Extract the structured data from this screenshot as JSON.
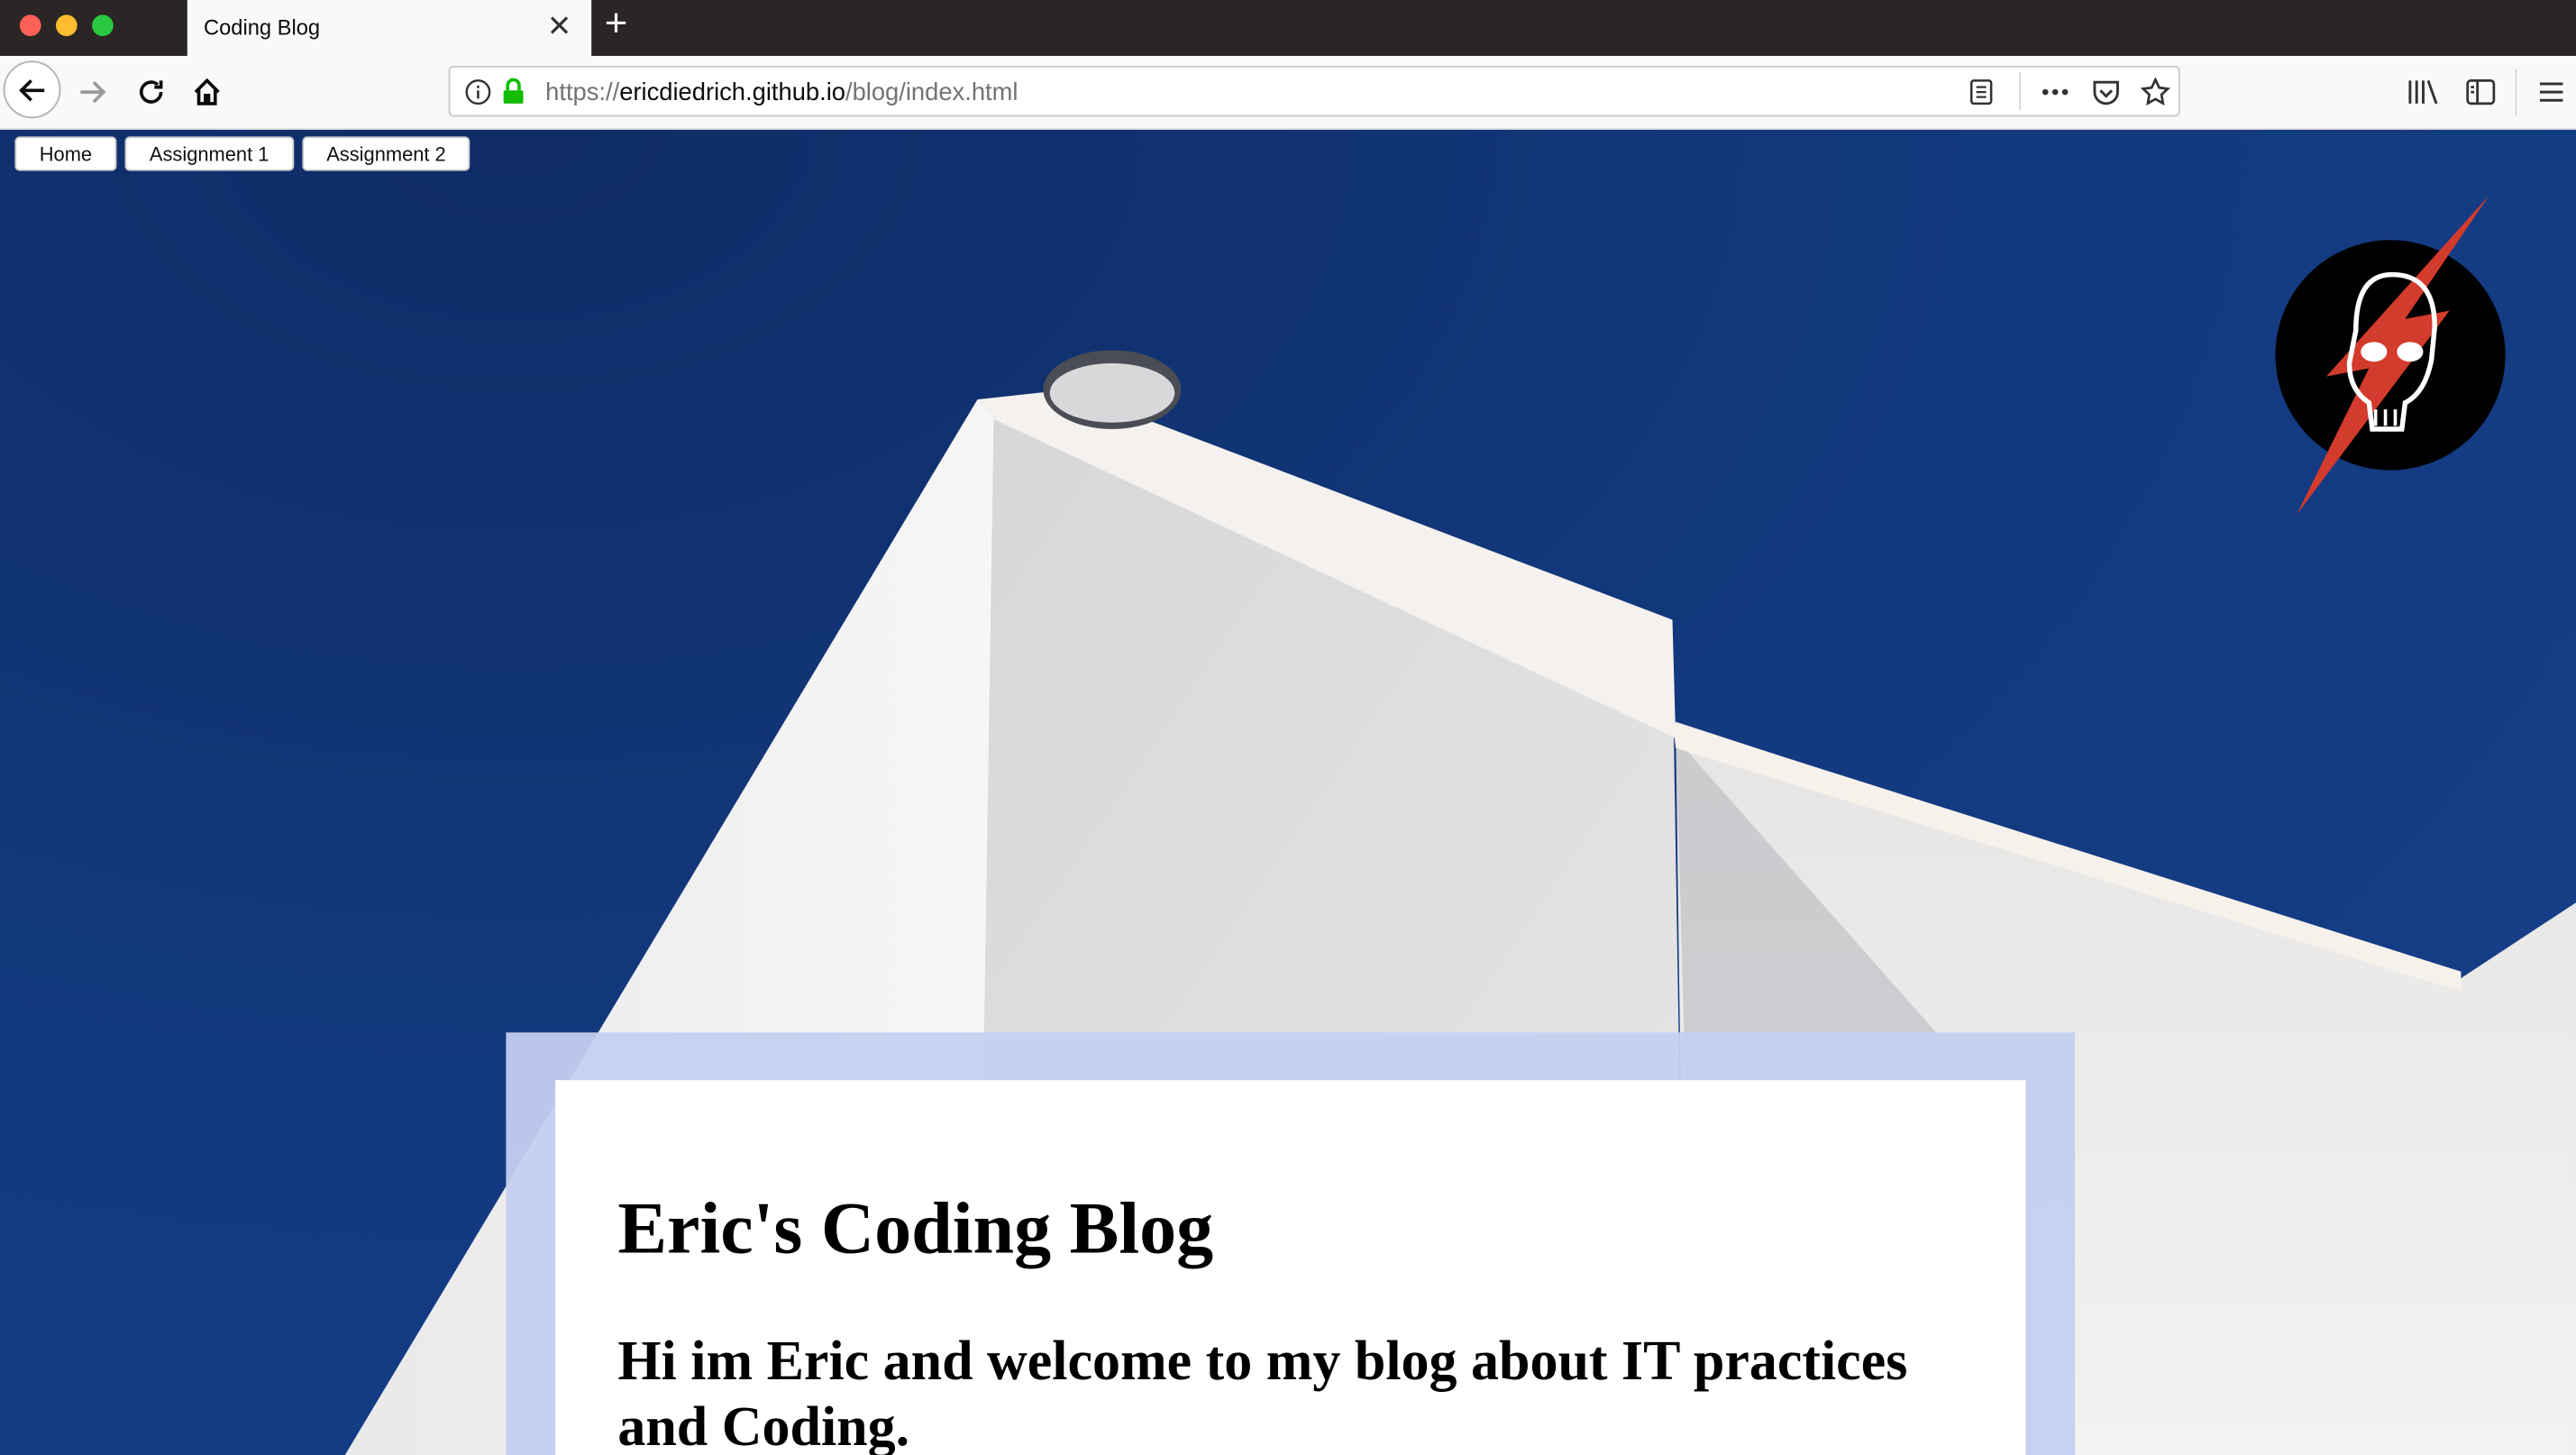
{
  "browser": {
    "tab_title": "Coding Blog",
    "tab_close_icon": "close-icon",
    "new_tab_icon": "plus-icon",
    "url_scheme": "https://",
    "url_host": "ericdiedrich.github.io",
    "url_path": "/blog/index.html",
    "toolbar_icons": [
      "back-arrow-icon",
      "forward-arrow-icon",
      "reload-icon",
      "home-icon",
      "info-icon",
      "lock-icon",
      "reader-view-icon",
      "more-icon",
      "pocket-icon",
      "bookmark-star-icon",
      "library-icon",
      "sidebar-icon",
      "menu-icon"
    ],
    "tab_strip_color": "#2b2625",
    "toolbar_color": "#f9f9fa",
    "lock_color": "#12bc00"
  },
  "page": {
    "nav": [
      "Home",
      "Assignment 1",
      "Assignment 2"
    ],
    "logo_icon": "skull-lightning-logo",
    "title": "Eric's Coding Blog",
    "subtitle": "Hi im Eric and welcome to my blog about IT practices and Coding.",
    "sky_color": "#123473",
    "card_border_color": "#c4cff0"
  }
}
